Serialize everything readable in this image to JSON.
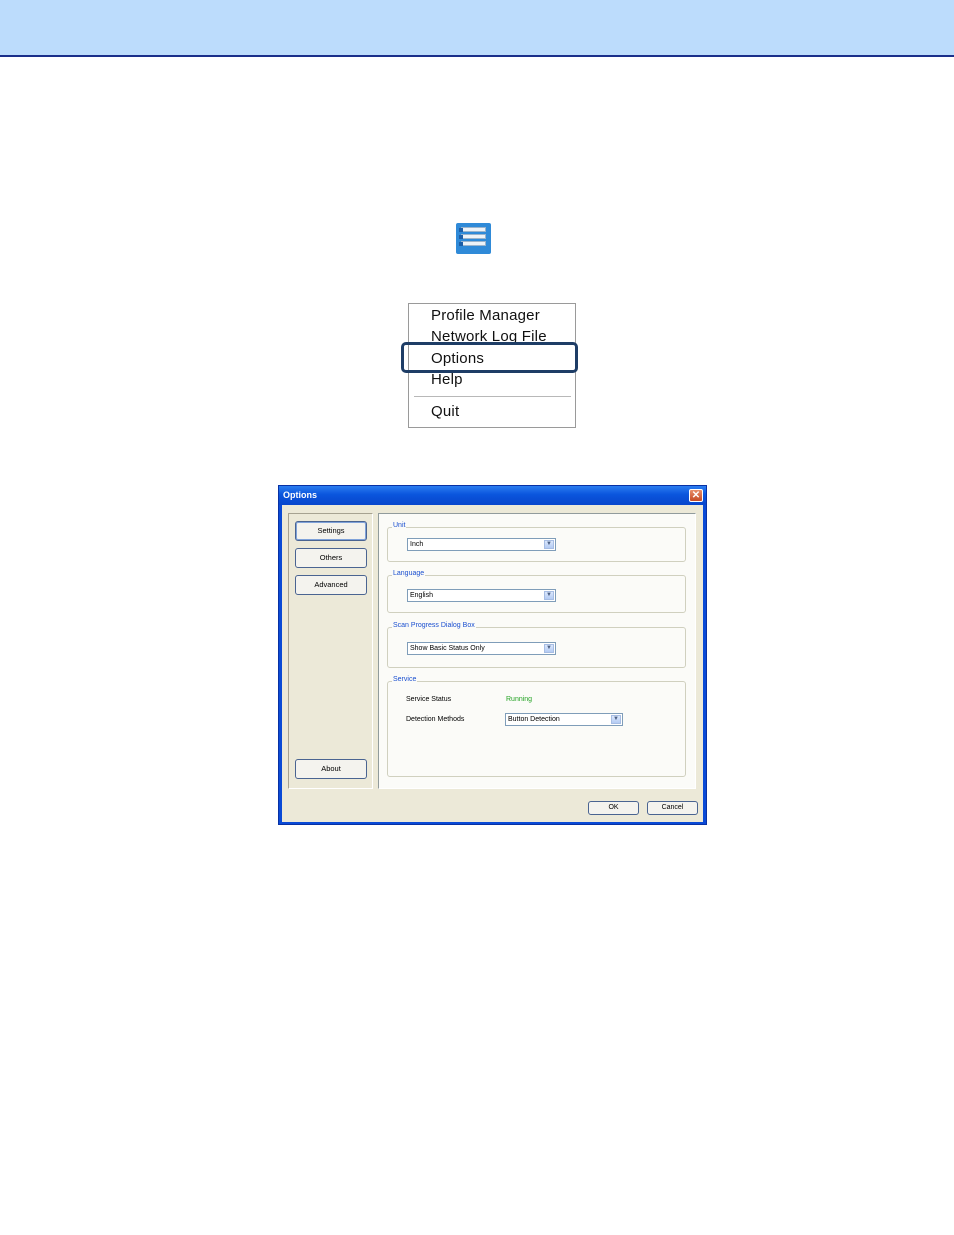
{
  "tray": {
    "icon": "profile-list-icon"
  },
  "context_menu": {
    "items": [
      "Profile Manager",
      "Network Log File",
      "Options",
      "Help",
      "Quit"
    ],
    "highlighted": "Options"
  },
  "dialog": {
    "title": "Options",
    "close_icon": "close-x-icon",
    "nav": {
      "settings": "Settings",
      "others": "Others",
      "advanced": "Advanced",
      "about": "About"
    },
    "unit": {
      "legend": "Unit",
      "value": "Inch"
    },
    "language": {
      "legend": "Language",
      "value": "English"
    },
    "scan_progress": {
      "legend": "Scan Progress Dialog Box",
      "value": "Show Basic Status Only"
    },
    "service": {
      "legend": "Service",
      "status_label": "Service Status",
      "status_value": "Running",
      "detection_label": "Detection Methods",
      "detection_value": "Button Detection"
    },
    "ok": "OK",
    "cancel": "Cancel",
    "colors": {
      "titlebar": "#0a55dd",
      "legend": "#1a4fd0",
      "running": "#22a222",
      "highlight": "#1e3d66"
    }
  }
}
